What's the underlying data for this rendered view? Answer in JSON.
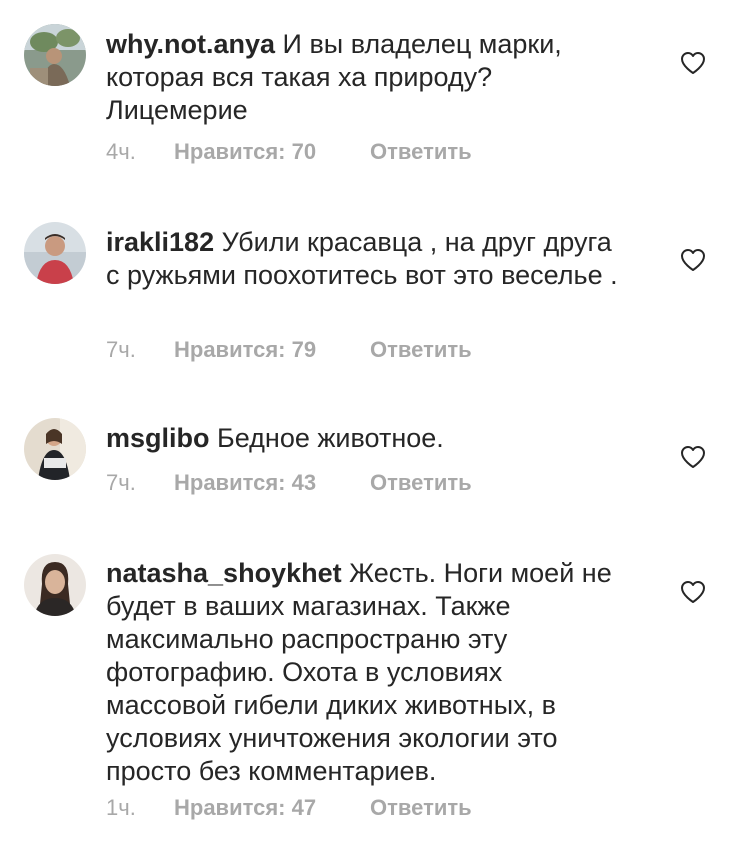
{
  "comments": [
    {
      "username": "why.not.anya",
      "text": "И вы владелец марки, которая вся такая ха природу? Лицемерие",
      "time": "4ч.",
      "likes": "Нравится: 70",
      "reply": "Ответить",
      "avatar_icon": "user-avatar-icon",
      "like_icon": "heart-icon"
    },
    {
      "username": "irakli182",
      "text": "Убили красавца , на друг друга с ружьями поохотитесь вот это веселье .",
      "time": "7ч.",
      "likes": "Нравится: 79",
      "reply": "Ответить",
      "avatar_icon": "user-avatar-icon",
      "like_icon": "heart-icon"
    },
    {
      "username": "msglibo",
      "text": "Бедное животное.",
      "time": "7ч.",
      "likes": "Нравится: 43",
      "reply": "Ответить",
      "avatar_icon": "user-avatar-icon",
      "like_icon": "heart-icon"
    },
    {
      "username": "natasha_shoykhet",
      "text": "Жесть. Ноги моей не будет в ваших магазинах. Также максимально распространю эту фотографию. Охота в условиях массовой гибели диких животных, в условиях уничтожения экологии это просто без комментариев.",
      "time": "1ч.",
      "likes": "Нравится: 47",
      "reply": "Ответить",
      "avatar_icon": "user-avatar-icon",
      "like_icon": "heart-icon"
    }
  ],
  "colors": {
    "text": "#262626",
    "meta": "#a8a8a8",
    "background": "#ffffff"
  }
}
